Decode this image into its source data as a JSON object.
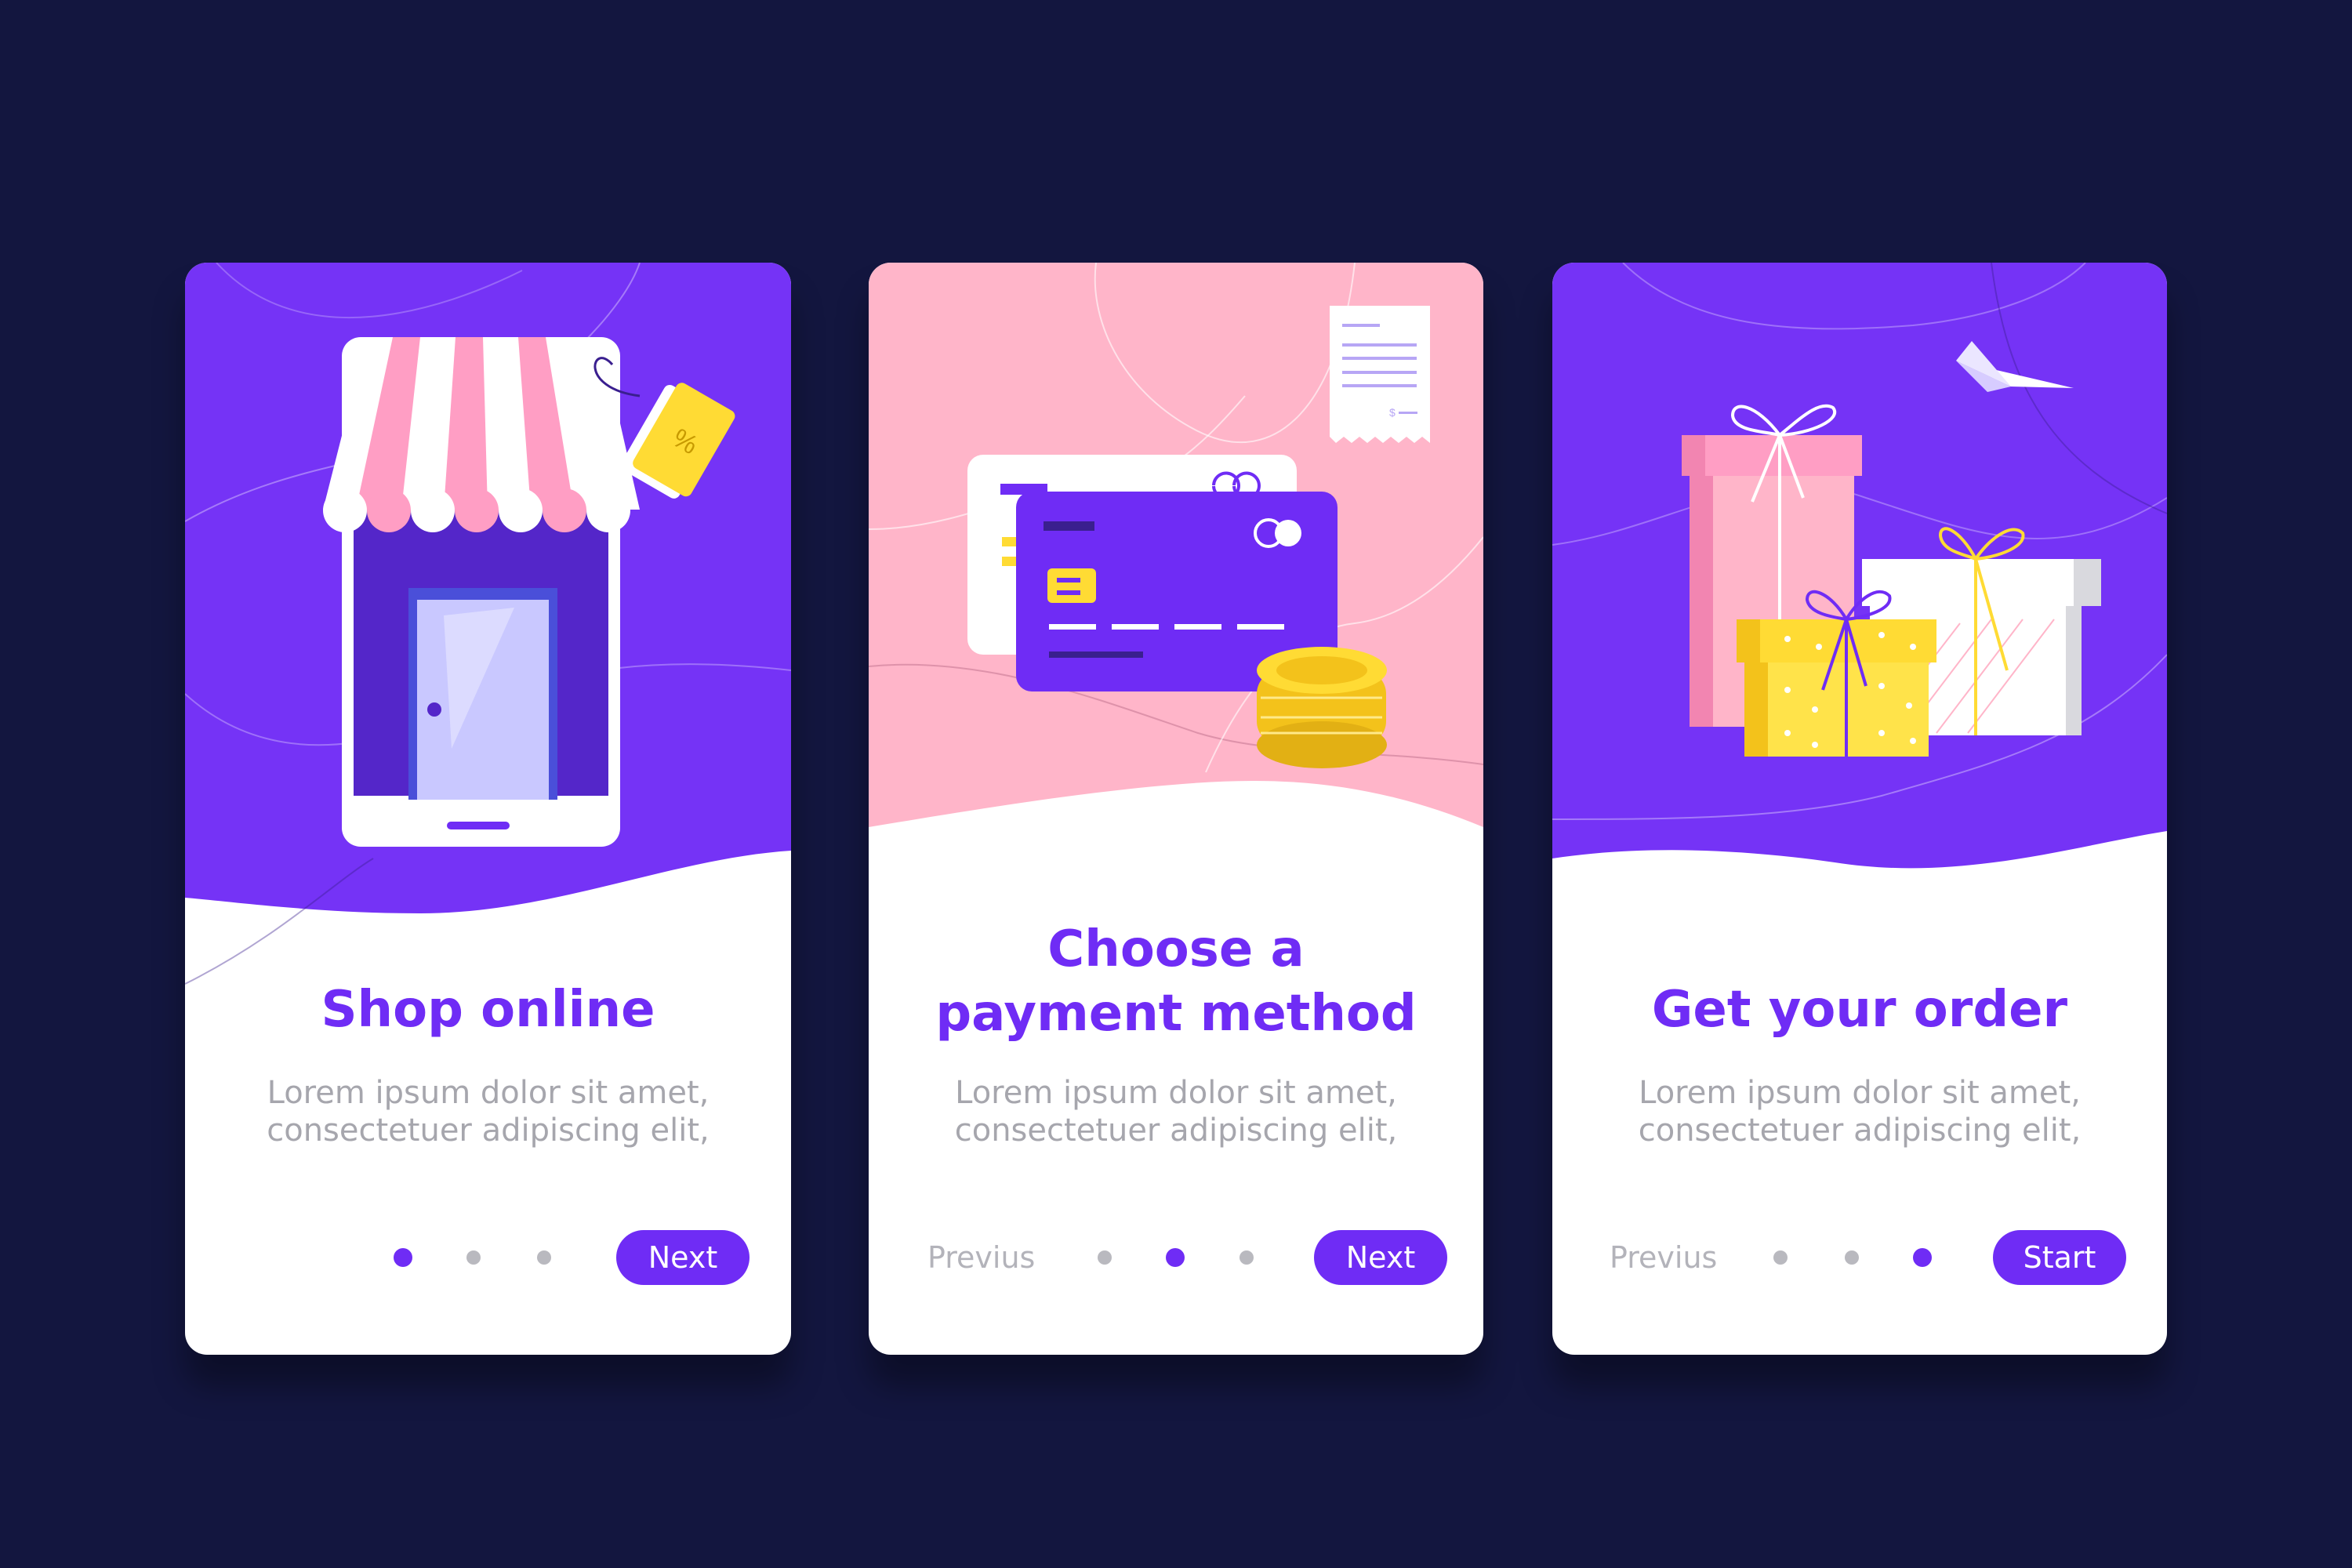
{
  "colors": {
    "background": "#13163f",
    "accent": "#6f2cf5",
    "pink": "#ffb5c9",
    "text_muted": "#a6a6ad"
  },
  "screens": [
    {
      "title_lines": [
        "Shop online"
      ],
      "body_lines": [
        "Lorem ipsum dolor sit amet,",
        "consectetuer adipiscing elit,"
      ],
      "button_label": "Next",
      "illustration": "storefront-phone-icon",
      "page_dots": {
        "total": 3,
        "active": 1
      }
    },
    {
      "title_lines": [
        "Choose a",
        "payment method"
      ],
      "body_lines": [
        "Lorem ipsum dolor sit amet,",
        "consectetuer adipiscing elit,"
      ],
      "previous_label": "Previus",
      "button_label": "Next",
      "illustration": "credit-card-icon",
      "page_dots": {
        "total": 3,
        "active": 2
      }
    },
    {
      "title_lines": [
        "Get your order"
      ],
      "body_lines": [
        "Lorem ipsum dolor sit amet,",
        "consectetuer adipiscing elit,"
      ],
      "previous_label": "Previus",
      "button_label": "Start",
      "illustration": "gift-boxes-icon",
      "page_dots": {
        "total": 3,
        "active": 3
      }
    }
  ]
}
